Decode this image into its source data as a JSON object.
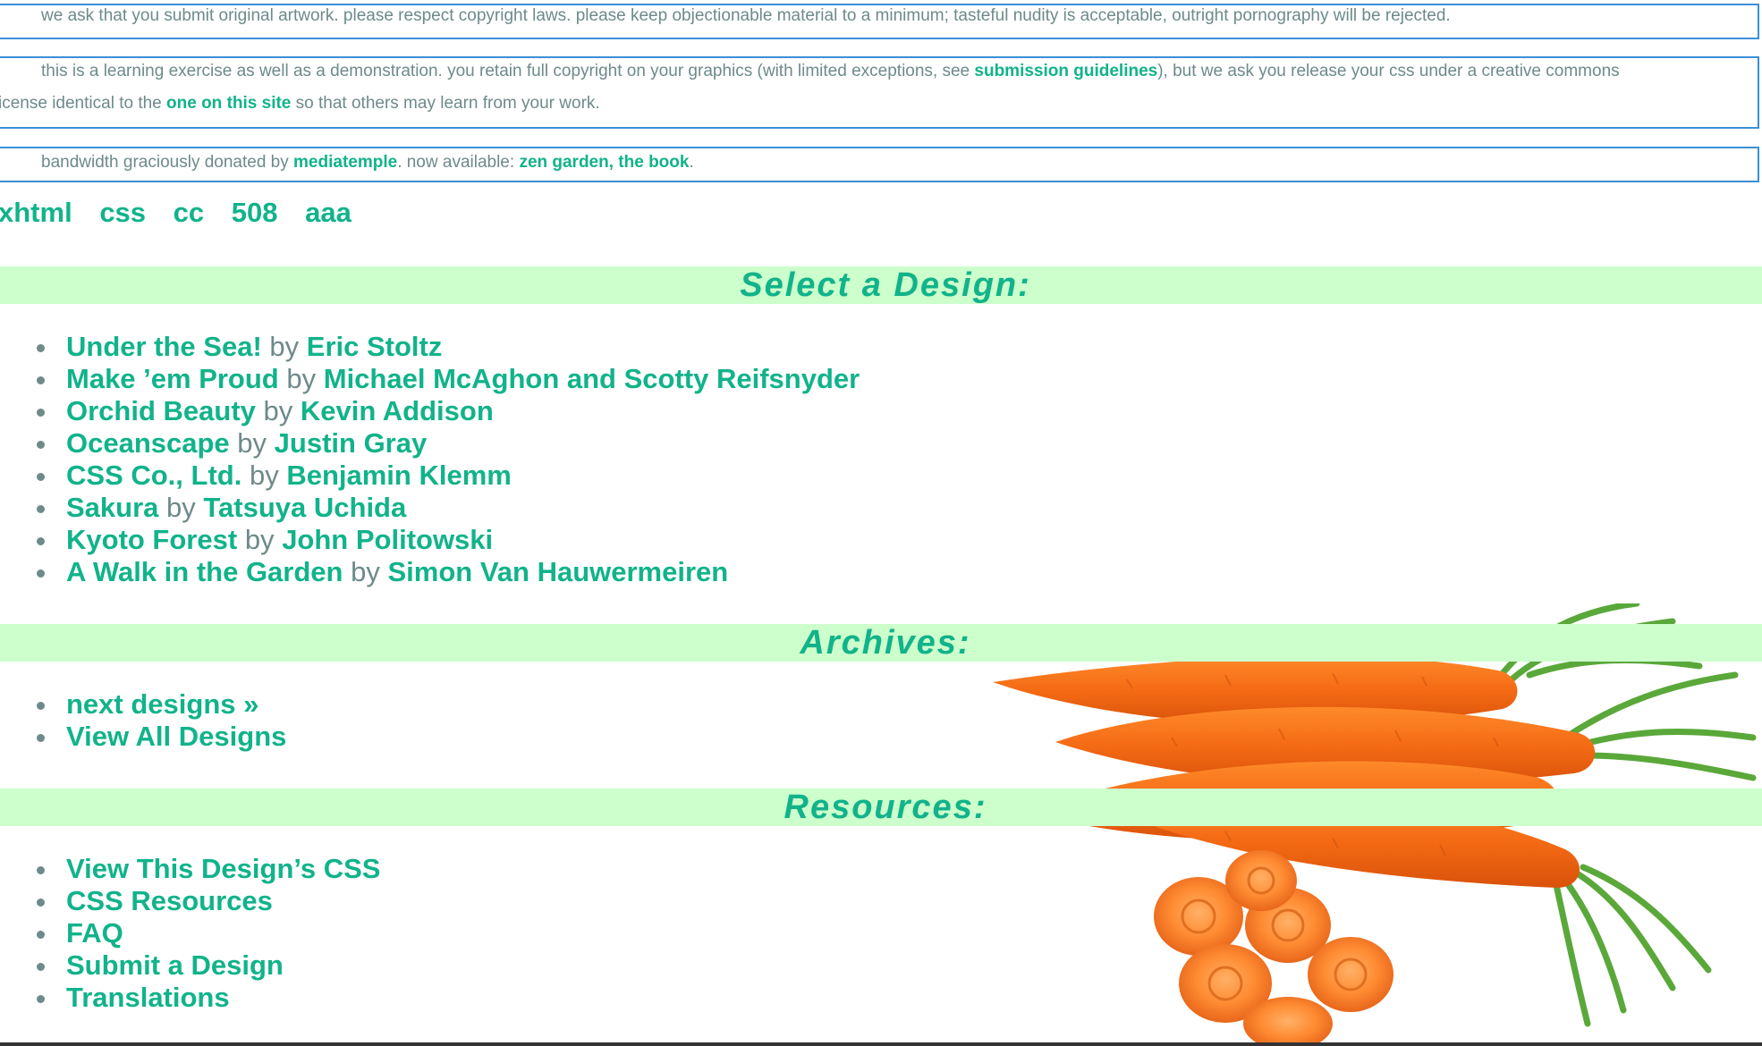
{
  "intro": {
    "p1": "we ask that you submit original artwork. please respect copyright laws. please keep objectionable material to a minimum; tasteful nudity is acceptable, outright pornography will be rejected.",
    "p2_a": "this is a learning exercise as well as a demonstration. you retain full copyright on your graphics (with limited exceptions, see ",
    "p2_link1": "submission guidelines",
    "p2_b": "), but we ask you release your css under a creative commons",
    "p2_c": "icense identical to the ",
    "p2_link2": "one on this site",
    "p2_d": " so that others may learn from your work.",
    "p3_a": "bandwidth graciously donated by ",
    "p3_link1": "mediatemple",
    "p3_b": ". now available: ",
    "p3_link2": "zen garden, the book",
    "p3_c": "."
  },
  "validators": [
    "xhtml",
    "css",
    "cc",
    "508",
    "aaa"
  ],
  "sections": {
    "select": {
      "title": "Select a Design:",
      "by": "by",
      "designs": [
        {
          "name": "Under the Sea!",
          "author": "Eric Stoltz"
        },
        {
          "name": "Make ’em Proud",
          "author": "Michael McAghon and Scotty Reifsnyder"
        },
        {
          "name": "Orchid Beauty",
          "author": "Kevin Addison"
        },
        {
          "name": "Oceanscape",
          "author": "Justin Gray"
        },
        {
          "name": "CSS Co., Ltd.",
          "author": "Benjamin Klemm"
        },
        {
          "name": "Sakura",
          "author": "Tatsuya Uchida"
        },
        {
          "name": "Kyoto Forest",
          "author": "John Politowski"
        },
        {
          "name": "A Walk in the Garden",
          "author": "Simon Van Hauwermeiren"
        }
      ]
    },
    "archives": {
      "title": "Archives:",
      "items": [
        "next designs »",
        "View All Designs"
      ]
    },
    "resources": {
      "title": "Resources:",
      "items": [
        "View This Design’s CSS",
        "CSS Resources",
        "FAQ",
        "Submit a Design",
        "Translations"
      ]
    }
  },
  "colors": {
    "link": "#11b38a",
    "text": "#6e8a8a",
    "band": "#ccffcc",
    "box_border": "#3b8fd8"
  },
  "image": {
    "icon": "carrots-image"
  }
}
